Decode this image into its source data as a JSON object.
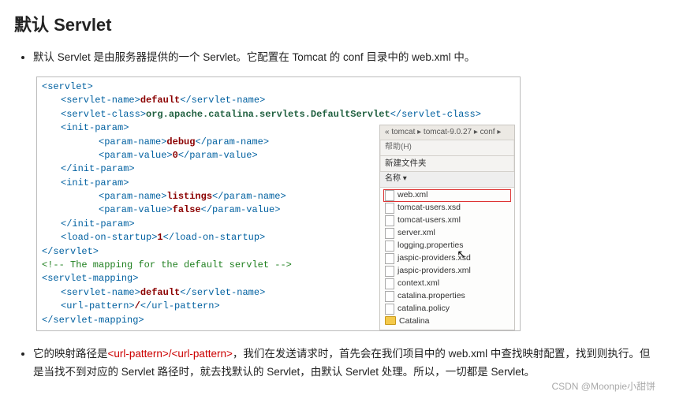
{
  "heading": "默认 Servlet",
  "bullet1": "默认 Servlet 是由服务器提供的一个 Servlet。它配置在 Tomcat 的 conf 目录中的 web.xml 中。",
  "bullet2_pre": "它的映射路径是",
  "bullet2_code": "<url-pattern>/<url-pattern>",
  "bullet2_post": "，我们在发送请求时，首先会在我们项目中的 web.xml 中查找映射配置，找到则执行。但是当找不到对应的 Servlet 路径时，就去找默认的 Servlet，由默认 Servlet 处理。所以，一切都是 Servlet。",
  "xml": {
    "l1_open": "<servlet>",
    "l2_open": "<servlet-name>",
    "l2_text": "default",
    "l2_close": "</servlet-name>",
    "l3_open": "<servlet-class>",
    "l3_text": "org.apache.catalina.servlets.DefaultServlet",
    "l3_close": "</servlet-class>",
    "l4_open": "<init-param>",
    "l5_open": "<param-name>",
    "l5_text": "debug",
    "l5_close": "</param-name>",
    "l6_open": "<param-value>",
    "l6_text": "0",
    "l6_close": "</param-value>",
    "l7_close": "</init-param>",
    "l8_open": "<init-param>",
    "l9_open": "<param-name>",
    "l9_text": "listings",
    "l9_close": "</param-name>",
    "l10_open": "<param-value>",
    "l10_text": "false",
    "l10_close": "</param-value>",
    "l11_close": "</init-param>",
    "l12_open": "<load-on-startup>",
    "l12_text": "1",
    "l12_close": "</load-on-startup>",
    "l13_close": "</servlet>",
    "comment": "<!-- The mapping for the default servlet -->",
    "m1_open": "<servlet-mapping>",
    "m2_open": "<servlet-name>",
    "m2_text": "default",
    "m2_close": "</servlet-name>",
    "m3_open": "<url-pattern>",
    "m3_text": "/",
    "m3_close": "</url-pattern>",
    "m4_close": "</servlet-mapping>"
  },
  "browser": {
    "path": "« tomcat ▸ tomcat-9.0.27 ▸ conf ▸",
    "menu": "帮助(H)",
    "action": "新建文件夹",
    "colhead": "名称 ▾",
    "files": [
      "web.xml",
      "tomcat-users.xsd",
      "tomcat-users.xml",
      "server.xml",
      "logging.properties",
      "jaspic-providers.xsd",
      "jaspic-providers.xml",
      "context.xml",
      "catalina.properties",
      "catalina.policy",
      "Catalina"
    ],
    "highlight_index": 0
  },
  "watermark": "CSDN @Moonpie小甜饼"
}
